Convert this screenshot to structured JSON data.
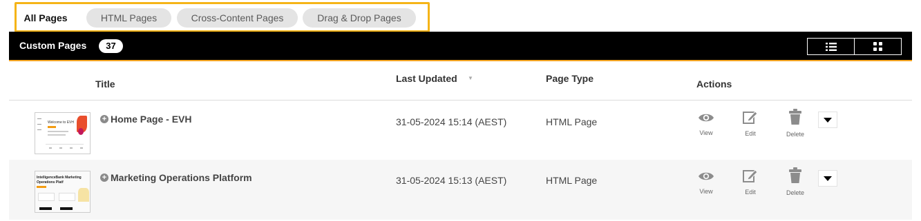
{
  "tabs": [
    {
      "label": "All Pages",
      "active": true
    },
    {
      "label": "HTML Pages",
      "active": false
    },
    {
      "label": "Cross-Content Pages",
      "active": false
    },
    {
      "label": "Drag & Drop Pages",
      "active": false
    }
  ],
  "header": {
    "title": "Custom Pages",
    "count": "37",
    "list_view_icon": "list-icon",
    "grid_view_icon": "grid-icon"
  },
  "table": {
    "columns": {
      "title": "Title",
      "last_updated": "Last Updated",
      "sort_indicator": "▼",
      "page_type": "Page Type",
      "actions": "Actions"
    },
    "rows": [
      {
        "title": "Home Page - EVH",
        "updated": "31-05-2024 15:14 (AEST)",
        "type": "HTML Page",
        "thumb_text": "Welcome to EVH"
      },
      {
        "title": "Marketing Operations Platform",
        "updated": "31-05-2024 15:13 (AEST)",
        "type": "HTML Page",
        "thumb_text": "IntelligenceBank Marketing Operations Platf"
      }
    ],
    "actions": {
      "view": "View",
      "edit": "Edit",
      "delete": "Delete"
    }
  },
  "colors": {
    "accent_orange": "#f5a623",
    "highlight_yellow": "#f5b417",
    "header_bg": "#000000"
  }
}
